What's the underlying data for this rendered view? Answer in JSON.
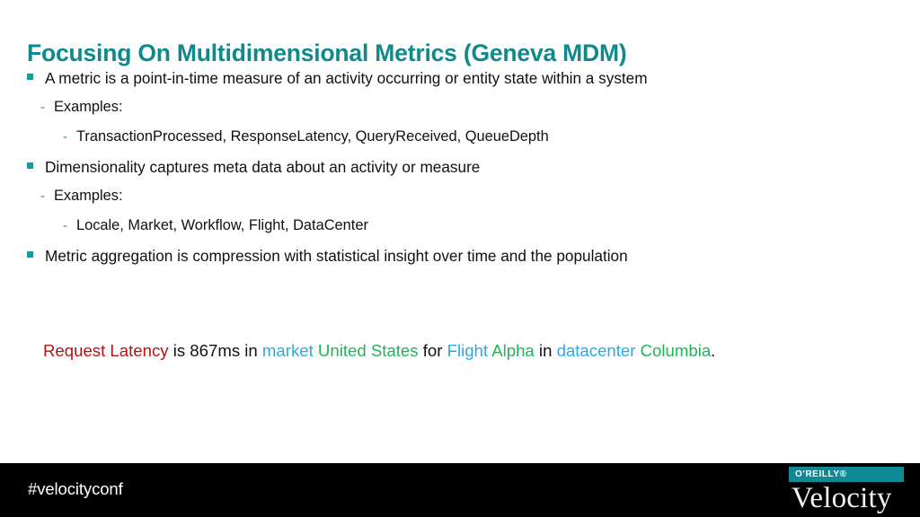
{
  "slide": {
    "title": "Focusing On Multidimensional Metrics (Geneva MDM)",
    "title_color": "#0e8a8c",
    "background_color": "#ffffff"
  },
  "bullets": [
    {
      "level": 1,
      "marker": "square-bullet",
      "text": "A metric is a point-in-time measure of an activity occurring or entity state within a system"
    },
    {
      "level": 2,
      "marker": "dash-bullet",
      "text": "Examples:"
    },
    {
      "level": 3,
      "marker": "dash-bullet",
      "text": "TransactionProcessed, ResponseLatency, QueryReceived, QueueDepth"
    },
    {
      "level": 1,
      "marker": "square-bullet",
      "text": "Dimensionality captures meta data about an activity or measure"
    },
    {
      "level": 2,
      "marker": "dash-bullet",
      "text": "Examples:"
    },
    {
      "level": 3,
      "marker": "dash-bullet",
      "text": "Locale, Market, Workflow, Flight, DataCenter"
    },
    {
      "level": 1,
      "marker": "square-bullet",
      "text": "Metric aggregation is compression with statistical insight over time and the population"
    }
  ],
  "example_sentence": {
    "segments": [
      {
        "text": "Request Latency",
        "role": "metric"
      },
      {
        "text": " is 867ms in ",
        "role": "plain"
      },
      {
        "text": "market",
        "role": "dimension"
      },
      {
        "text": " ",
        "role": "plain"
      },
      {
        "text": "United States",
        "role": "value"
      },
      {
        "text": " for ",
        "role": "plain"
      },
      {
        "text": "Flight",
        "role": "dimension"
      },
      {
        "text": " ",
        "role": "plain"
      },
      {
        "text": "Alpha",
        "role": "value"
      },
      {
        "text": " in ",
        "role": "plain"
      },
      {
        "text": "datacenter",
        "role": "dimension"
      },
      {
        "text": " ",
        "role": "plain"
      },
      {
        "text": "Columbia",
        "role": "value"
      },
      {
        "text": ".",
        "role": "plain"
      }
    ],
    "colors": {
      "metric": "#b01414",
      "plain": "#111111",
      "dimension": "#29abe2",
      "value": "#22b457"
    }
  },
  "footer": {
    "background_color": "#000000",
    "hashtag": "#velocityconf",
    "logo": {
      "publisher": "O'REILLY®",
      "brand": "Velocity",
      "bar_color": "#0e8a95"
    }
  }
}
